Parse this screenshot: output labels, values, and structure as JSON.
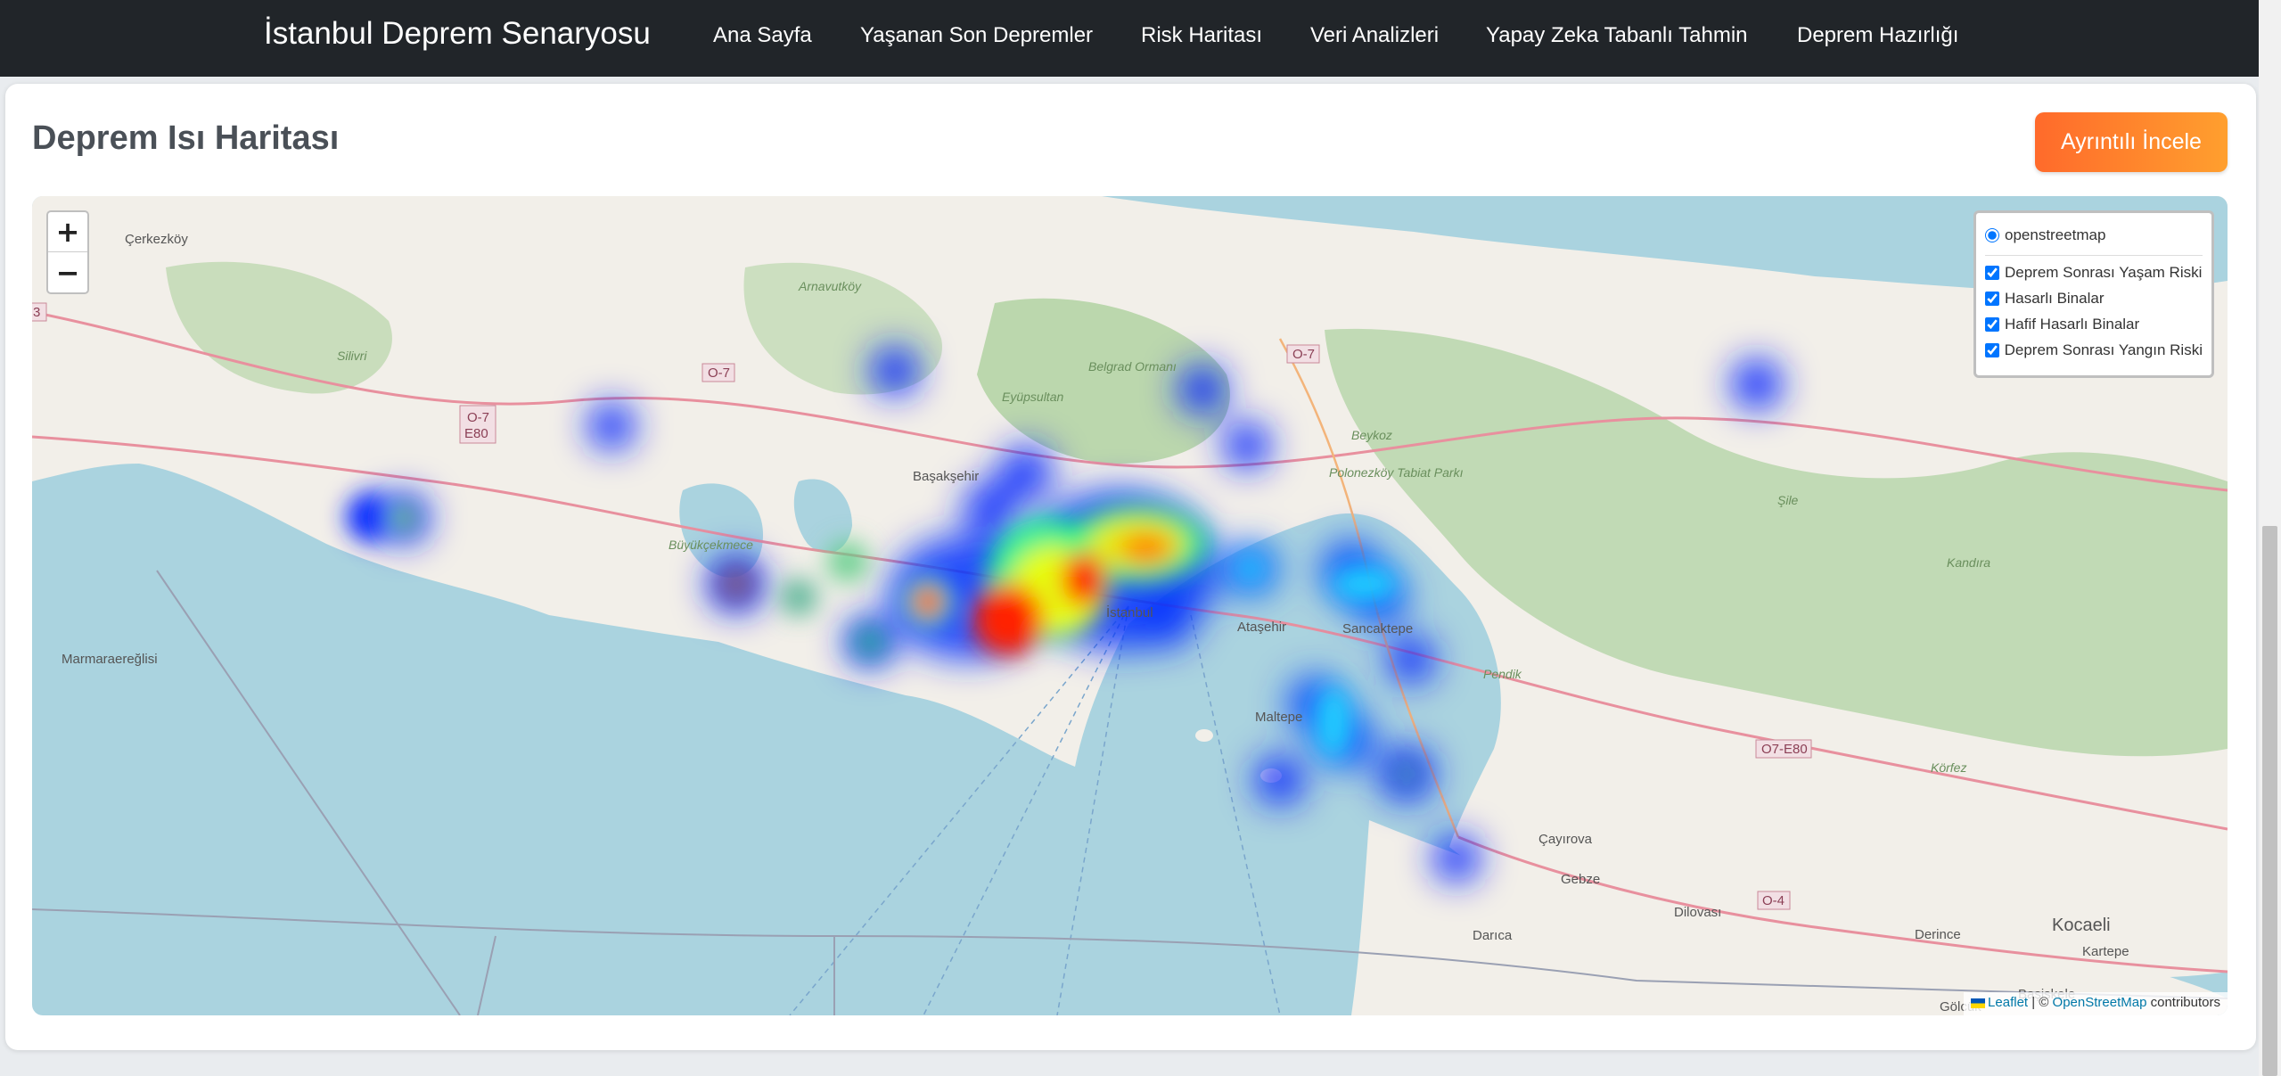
{
  "navbar": {
    "brand": "İstanbul Deprem Senaryosu",
    "links": [
      "Ana Sayfa",
      "Yaşanan Son Depremler",
      "Risk Haritası",
      "Veri Analizleri",
      "Yapay Zeka Tabanlı Tahmin",
      "Deprem Hazırlığı"
    ]
  },
  "card": {
    "title": "Deprem Isı Haritası",
    "detail_button": "Ayrıntılı İncele"
  },
  "map": {
    "zoom_in": "+",
    "zoom_out": "−",
    "base_layer": "openstreetmap",
    "overlays": [
      "Deprem Sonrası Yaşam Riski",
      "Hasarlı Binalar",
      "Hafif Hasarlı Binalar",
      "Deprem Sonrası Yangın Riski"
    ],
    "attribution": {
      "leaflet": "Leaflet",
      "separator": " | © ",
      "osm": "OpenStreetMap",
      "suffix": " contributors"
    },
    "place_labels": {
      "cerkezkoy": "Çerkezköy",
      "silivri": "Silivri",
      "arnavutkoy": "Arnavutköy",
      "basaksehir": "Başakşehir",
      "buyukcekmece": "Büyükçekmece",
      "marmaraereglisi": "Marmaraereğlisi",
      "belgrad": "Belgrad Ormanı",
      "eyupsultan": "Eyüpsultan",
      "beykoz": "Beykoz",
      "polonezkoy": "Polonezköy Tabiat Parkı",
      "sile": "Şile",
      "atasehir": "Ataşehir",
      "sancaktepe": "Sancaktepe",
      "pendik": "Pendik",
      "maltepe": "Maltepe",
      "cayirova": "Çayırova",
      "gebze": "Gebze",
      "darica": "Darıca",
      "dilovasi": "Dilovası",
      "derince": "Derince",
      "kocaeli": "Kocaeli",
      "kartepe": "Kartepe",
      "basiskele": "Başiskele",
      "golcuk": "Gölcük",
      "korfez": "Körfez",
      "kandira": "Kandıra",
      "istanbul": "İstanbul",
      "road_o7_west": "O-7",
      "road_e80": "E80",
      "road_o7": "O-7",
      "road_o7_north": "O-7",
      "road_o7_e80": "O7-E80",
      "road_o4": "O-4",
      "road_3": "3"
    }
  },
  "colors": {
    "navbar_bg": "#212529",
    "button_start": "#ff6a2b",
    "button_end": "#ff9f2e",
    "sea": "#aad3df",
    "land": "#f2efe9",
    "forest": "#add19e"
  }
}
